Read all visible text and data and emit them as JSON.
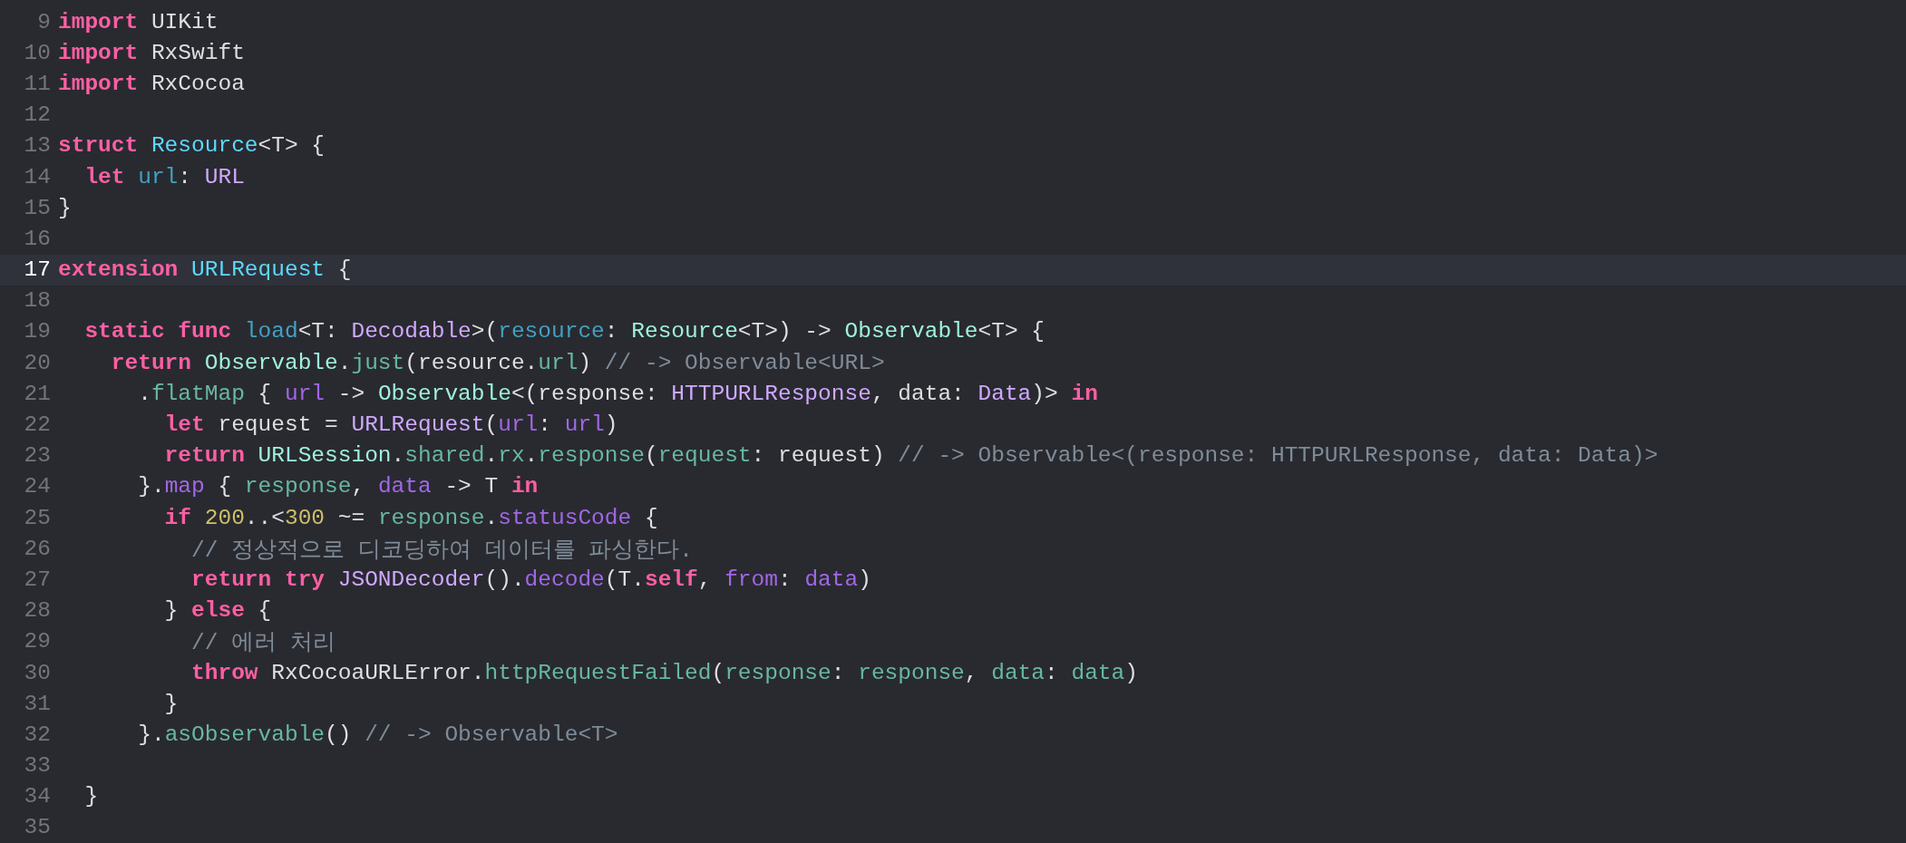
{
  "editor": {
    "lines": [
      {
        "number": "9",
        "current": false,
        "tokens": [
          {
            "text": "import",
            "kind": "keyword"
          },
          {
            "text": " UIKit",
            "kind": "plain"
          }
        ]
      },
      {
        "number": "10",
        "current": false,
        "tokens": [
          {
            "text": "import",
            "kind": "keyword"
          },
          {
            "text": " RxSwift",
            "kind": "plain"
          }
        ]
      },
      {
        "number": "11",
        "current": false,
        "tokens": [
          {
            "text": "import",
            "kind": "keyword"
          },
          {
            "text": " RxCocoa",
            "kind": "plain"
          }
        ]
      },
      {
        "number": "12",
        "current": false
      },
      {
        "number": "13",
        "current": false,
        "tokens": [
          {
            "text": "struct ",
            "kind": "keyword"
          },
          {
            "text": "Resource",
            "kind": "declaration"
          },
          {
            "text": "<T> {",
            "kind": "plain"
          }
        ]
      },
      {
        "number": "14",
        "current": false,
        "tokens": [
          {
            "text": "  let ",
            "kind": "keyword"
          },
          {
            "text": "url",
            "kind": "other-declaration"
          },
          {
            "text": ": ",
            "kind": "plain"
          },
          {
            "text": "URL",
            "kind": "system-type"
          }
        ]
      },
      {
        "number": "15",
        "current": false,
        "tokens": [
          {
            "text": "}",
            "kind": "plain"
          }
        ]
      },
      {
        "number": "16",
        "current": false
      },
      {
        "number": "17",
        "current": true,
        "tokens": [
          {
            "text": "extension ",
            "kind": "keyword"
          },
          {
            "text": "URLRequest",
            "kind": "declaration"
          },
          {
            "text": " {",
            "kind": "plain"
          }
        ]
      },
      {
        "number": "18",
        "current": false
      },
      {
        "number": "19",
        "current": false,
        "tokens": [
          {
            "text": "  static func ",
            "kind": "keyword"
          },
          {
            "text": "load",
            "kind": "other-declaration"
          },
          {
            "text": "<T: ",
            "kind": "plain"
          },
          {
            "text": "Decodable",
            "kind": "system-type"
          },
          {
            "text": ">(",
            "kind": "plain"
          },
          {
            "text": "resource",
            "kind": "other-declaration"
          },
          {
            "text": ": ",
            "kind": "plain"
          },
          {
            "text": "Resource",
            "kind": "project-type"
          },
          {
            "text": "<T>) -> ",
            "kind": "plain"
          },
          {
            "text": "Observable",
            "kind": "project-type"
          },
          {
            "text": "<T> {",
            "kind": "plain"
          }
        ]
      },
      {
        "number": "20",
        "current": false,
        "tokens": [
          {
            "text": "    return ",
            "kind": "keyword"
          },
          {
            "text": "Observable",
            "kind": "project-type"
          },
          {
            "text": ".",
            "kind": "plain"
          },
          {
            "text": "just",
            "kind": "project-member"
          },
          {
            "text": "(resource.",
            "kind": "plain"
          },
          {
            "text": "url",
            "kind": "project-member"
          },
          {
            "text": ") ",
            "kind": "plain"
          },
          {
            "text": "// -> Observable<URL>",
            "kind": "comment"
          }
        ]
      },
      {
        "number": "21",
        "current": false,
        "tokens": [
          {
            "text": "      .",
            "kind": "plain"
          },
          {
            "text": "flatMap",
            "kind": "project-member"
          },
          {
            "text": " { ",
            "kind": "plain"
          },
          {
            "text": "url",
            "kind": "system-member"
          },
          {
            "text": " -> ",
            "kind": "plain"
          },
          {
            "text": "Observable",
            "kind": "project-type"
          },
          {
            "text": "<(response: ",
            "kind": "plain"
          },
          {
            "text": "HTTPURLResponse",
            "kind": "system-type"
          },
          {
            "text": ", data: ",
            "kind": "plain"
          },
          {
            "text": "Data",
            "kind": "system-type"
          },
          {
            "text": ")> ",
            "kind": "plain"
          },
          {
            "text": "in",
            "kind": "keyword"
          }
        ]
      },
      {
        "number": "22",
        "current": false,
        "tokens": [
          {
            "text": "        let",
            "kind": "keyword"
          },
          {
            "text": " request = ",
            "kind": "plain"
          },
          {
            "text": "URLRequest",
            "kind": "system-type"
          },
          {
            "text": "(",
            "kind": "plain"
          },
          {
            "text": "url",
            "kind": "system-member"
          },
          {
            "text": ": ",
            "kind": "plain"
          },
          {
            "text": "url",
            "kind": "system-member"
          },
          {
            "text": ")",
            "kind": "plain"
          }
        ]
      },
      {
        "number": "23",
        "current": false,
        "tokens": [
          {
            "text": "        return ",
            "kind": "keyword"
          },
          {
            "text": "URLSession",
            "kind": "project-type"
          },
          {
            "text": ".",
            "kind": "plain"
          },
          {
            "text": "shared",
            "kind": "project-member"
          },
          {
            "text": ".",
            "kind": "plain"
          },
          {
            "text": "rx",
            "kind": "project-member"
          },
          {
            "text": ".",
            "kind": "plain"
          },
          {
            "text": "response",
            "kind": "project-member"
          },
          {
            "text": "(",
            "kind": "plain"
          },
          {
            "text": "request",
            "kind": "project-member"
          },
          {
            "text": ": request) ",
            "kind": "plain"
          },
          {
            "text": "// -> Observable<(response: HTTPURLResponse, data: Data)>",
            "kind": "comment"
          }
        ]
      },
      {
        "number": "24",
        "current": false,
        "tokens": [
          {
            "text": "      }.",
            "kind": "plain"
          },
          {
            "text": "map",
            "kind": "system-member"
          },
          {
            "text": " { ",
            "kind": "plain"
          },
          {
            "text": "response",
            "kind": "project-member"
          },
          {
            "text": ", ",
            "kind": "plain"
          },
          {
            "text": "data",
            "kind": "system-member"
          },
          {
            "text": " -> T ",
            "kind": "plain"
          },
          {
            "text": "in",
            "kind": "keyword"
          }
        ]
      },
      {
        "number": "25",
        "current": false,
        "tokens": [
          {
            "text": "        if ",
            "kind": "keyword"
          },
          {
            "text": "200",
            "kind": "number"
          },
          {
            "text": "..<",
            "kind": "plain"
          },
          {
            "text": "300",
            "kind": "number"
          },
          {
            "text": " ~= ",
            "kind": "plain"
          },
          {
            "text": "response",
            "kind": "project-member"
          },
          {
            "text": ".",
            "kind": "plain"
          },
          {
            "text": "statusCode",
            "kind": "system-member"
          },
          {
            "text": " {",
            "kind": "plain"
          }
        ]
      },
      {
        "number": "26",
        "current": false,
        "tokens": [
          {
            "text": "          // 정상적으로 디코딩하여 데이터를 파싱한다.",
            "kind": "comment"
          }
        ]
      },
      {
        "number": "27",
        "current": false,
        "tokens": [
          {
            "text": "          return try ",
            "kind": "keyword"
          },
          {
            "text": "JSONDecoder",
            "kind": "system-type"
          },
          {
            "text": "().",
            "kind": "plain"
          },
          {
            "text": "decode",
            "kind": "system-member"
          },
          {
            "text": "(T.",
            "kind": "plain"
          },
          {
            "text": "self",
            "kind": "keyword"
          },
          {
            "text": ", ",
            "kind": "plain"
          },
          {
            "text": "from",
            "kind": "system-member"
          },
          {
            "text": ": ",
            "kind": "plain"
          },
          {
            "text": "data",
            "kind": "system-member"
          },
          {
            "text": ")",
            "kind": "plain"
          }
        ]
      },
      {
        "number": "28",
        "current": false,
        "tokens": [
          {
            "text": "        } ",
            "kind": "plain"
          },
          {
            "text": "else",
            "kind": "keyword"
          },
          {
            "text": " {",
            "kind": "plain"
          }
        ]
      },
      {
        "number": "29",
        "current": false,
        "tokens": [
          {
            "text": "          // 에러 처리",
            "kind": "comment"
          }
        ]
      },
      {
        "number": "30",
        "current": false,
        "tokens": [
          {
            "text": "          throw",
            "kind": "keyword"
          },
          {
            "text": " RxCocoaURLError.",
            "kind": "plain"
          },
          {
            "text": "httpRequestFailed",
            "kind": "project-member"
          },
          {
            "text": "(",
            "kind": "plain"
          },
          {
            "text": "response",
            "kind": "project-member"
          },
          {
            "text": ": ",
            "kind": "plain"
          },
          {
            "text": "response",
            "kind": "project-member"
          },
          {
            "text": ", ",
            "kind": "plain"
          },
          {
            "text": "data",
            "kind": "project-member"
          },
          {
            "text": ": ",
            "kind": "plain"
          },
          {
            "text": "data",
            "kind": "project-member"
          },
          {
            "text": ")",
            "kind": "plain"
          }
        ]
      },
      {
        "number": "31",
        "current": false,
        "tokens": [
          {
            "text": "        }",
            "kind": "plain"
          }
        ]
      },
      {
        "number": "32",
        "current": false,
        "tokens": [
          {
            "text": "      }.",
            "kind": "plain"
          },
          {
            "text": "asObservable",
            "kind": "project-member"
          },
          {
            "text": "() ",
            "kind": "plain"
          },
          {
            "text": "// -> Observable<T>",
            "kind": "comment"
          }
        ]
      },
      {
        "number": "33",
        "current": false
      },
      {
        "number": "34",
        "current": false,
        "tokens": [
          {
            "text": "  }",
            "kind": "plain"
          }
        ]
      },
      {
        "number": "35",
        "current": false
      }
    ]
  }
}
